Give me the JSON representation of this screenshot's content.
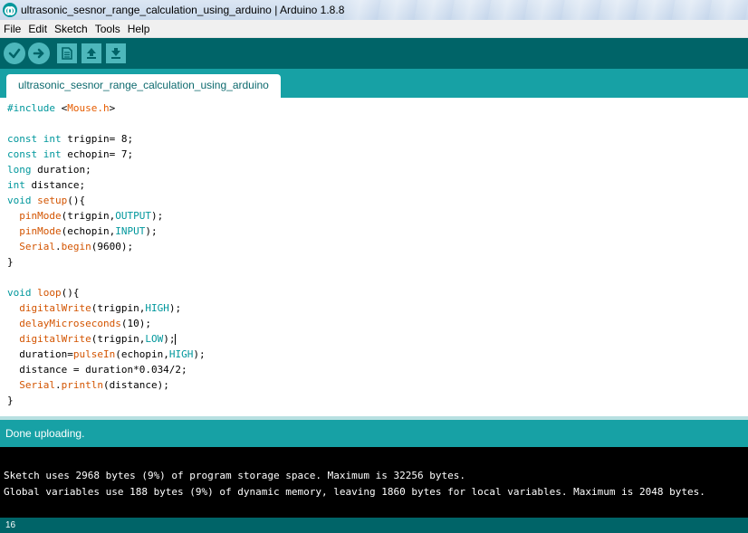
{
  "window": {
    "title": "ultrasonic_sesnor_range_calculation_using_arduino | Arduino 1.8.8",
    "icon": "arduino-logo-icon"
  },
  "menu": [
    "File",
    "Edit",
    "Sketch",
    "Tools",
    "Help"
  ],
  "toolbar": {
    "buttons": [
      "verify-icon",
      "upload-icon",
      "new-icon",
      "open-icon",
      "save-icon"
    ],
    "colors": {
      "bar": "#006468",
      "button": "#4db7bb"
    }
  },
  "tabs": [
    {
      "label": "ultrasonic_sesnor_range_calculation_using_arduino",
      "active": true
    }
  ],
  "editor": {
    "lines": [
      "#include <Mouse.h>",
      "",
      "const int trigpin= 8;",
      "const int echopin= 7;",
      "long duration;",
      "int distance;",
      "void setup(){",
      "  pinMode(trigpin,OUTPUT);",
      "  pinMode(echopin,INPUT);",
      "  Serial.begin(9600);",
      "}",
      "",
      "void loop(){",
      "  digitalWrite(trigpin,HIGH);",
      "  delayMicroseconds(10);",
      "  digitalWrite(trigpin,LOW);",
      "  duration=pulseIn(echopin,HIGH);",
      "  distance = duration*0.034/2;",
      "  Serial.println(distance);",
      "}"
    ]
  },
  "status": {
    "message": "Done uploading."
  },
  "console": {
    "lines": [
      "Sketch uses 2968 bytes (9%) of program storage space. Maximum is 32256 bytes.",
      "Global variables use 188 bytes (9%) of dynamic memory, leaving 1860 bytes for local variables. Maximum is 2048 bytes."
    ]
  },
  "footer": {
    "line_number": "16"
  },
  "colors": {
    "accent": "#17a1a5",
    "dark_teal": "#006468",
    "keyword": "#00979c",
    "function": "#d35400"
  }
}
